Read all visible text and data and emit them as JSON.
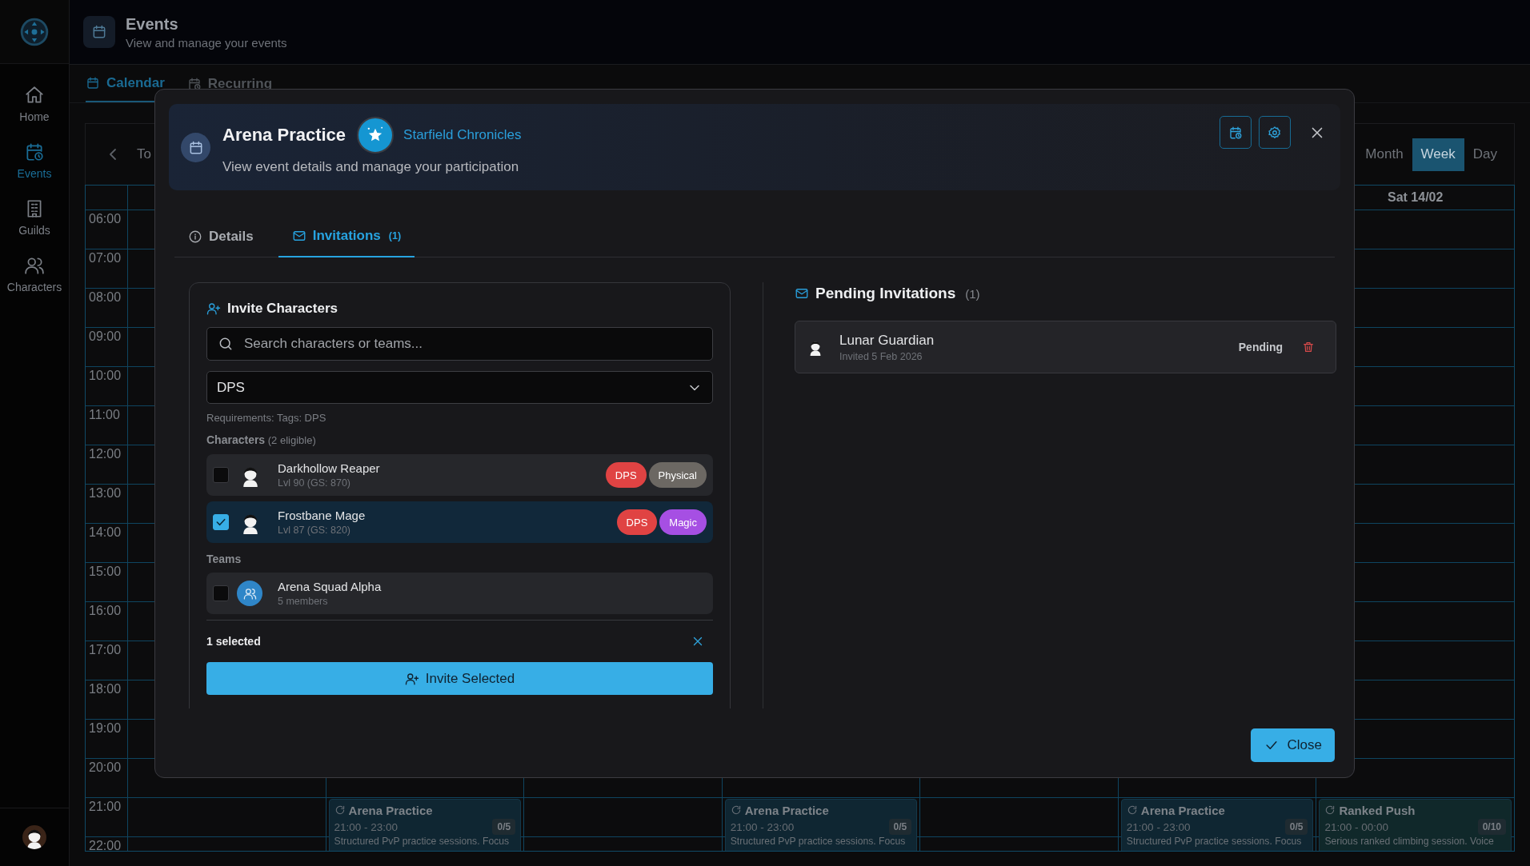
{
  "sidebar": {
    "items": [
      {
        "label": "Home",
        "selected": false
      },
      {
        "label": "Events",
        "selected": true
      },
      {
        "label": "Guilds",
        "selected": false
      },
      {
        "label": "Characters",
        "selected": false
      }
    ]
  },
  "header": {
    "title": "Events",
    "subtitle": "View and manage your events"
  },
  "page_tabs": [
    {
      "label": "Calendar",
      "selected": true
    },
    {
      "label": "Recurring",
      "selected": false
    }
  ],
  "toolbar": {
    "today": "To",
    "views": [
      {
        "label": "Month",
        "selected": false
      },
      {
        "label": "Week",
        "selected": true
      },
      {
        "label": "Day",
        "selected": false
      }
    ]
  },
  "calendar": {
    "day_header": "Sat 14/02",
    "times": [
      "06:00",
      "07:00",
      "08:00",
      "09:00",
      "10:00",
      "11:00",
      "12:00",
      "13:00",
      "14:00",
      "15:00",
      "16:00",
      "17:00",
      "18:00",
      "19:00",
      "20:00",
      "21:00",
      "22:00"
    ],
    "events": {
      "mon": {
        "title": "Arena Practice",
        "time": "21:00 - 23:00",
        "count": "0/5",
        "description": "Structured PvP practice sessions. Focus",
        "recurring": true,
        "color": "#0f2632"
      },
      "wed": {
        "title": "Arena Practice",
        "time": "21:00 - 23:00",
        "count": "0/5",
        "description": "Structured PvP practice sessions. Focus",
        "recurring": true,
        "color": "#0f2632"
      },
      "fri": {
        "title": "Arena Practice",
        "time": "21:00 - 23:00",
        "count": "0/5",
        "description": "Structured PvP practice sessions. Focus",
        "recurring": true,
        "color": "#0f2632"
      },
      "sat": {
        "title": "Ranked Push",
        "time": "21:00 - 00:00",
        "count": "0/10",
        "description": "Serious ranked climbing session. Voice",
        "recurring": true,
        "color": "#10282a"
      }
    }
  },
  "modal": {
    "title": "Arena Practice",
    "game": "Starfield Chronicles",
    "subtitle": "View event details and manage your participation",
    "tabs": [
      {
        "label": "Details",
        "selected": false
      },
      {
        "label": "Invitations",
        "count": "(1)",
        "selected": true
      }
    ],
    "invite": {
      "title": "Invite Characters",
      "search": {
        "placeholder": "Search characters or teams..."
      },
      "filter": {
        "value": "DPS"
      },
      "requirements": "Requirements: Tags: DPS",
      "characters_label": "Characters",
      "characters_count": "(2 eligible)",
      "characters": [
        {
          "name": "Darkhollow Reaper",
          "detail": "Lvl 90 (GS: 870)",
          "checked": false,
          "tags": [
            {
              "label": "DPS",
              "color": "#e04343"
            },
            {
              "label": "Physical",
              "color": "#6c6863"
            }
          ]
        },
        {
          "name": "Frostbane Mage",
          "detail": "Lvl 87 (GS: 820)",
          "checked": true,
          "tags": [
            {
              "label": "DPS",
              "color": "#e04343"
            },
            {
              "label": "Magic",
              "color": "#a64fe3"
            }
          ]
        }
      ],
      "teams_label": "Teams",
      "teams": [
        {
          "name": "Arena Squad Alpha",
          "detail": "5 members",
          "checked": false
        }
      ],
      "selection": "1 selected",
      "invite_button": "Invite Selected"
    },
    "pending": {
      "title": "Pending Invitations",
      "count": "(1)",
      "items": [
        {
          "name": "Lunar Guardian",
          "detail": "Invited 5 Feb 2026",
          "status": "Pending"
        }
      ]
    },
    "close_button": "Close"
  }
}
